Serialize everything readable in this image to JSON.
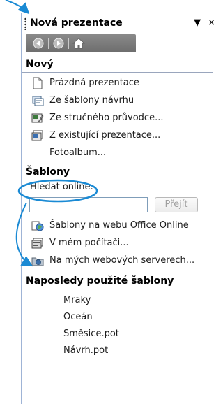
{
  "pane": {
    "title": "Nová prezentace",
    "dropdown_icon": "▼",
    "close_icon": "×"
  },
  "nav": {
    "back_icon": "arrow-left-icon",
    "forward_icon": "arrow-right-icon",
    "home_icon": "home-icon"
  },
  "new_section": {
    "heading": "Nový",
    "items": [
      {
        "label": "Prázdná prezentace",
        "icon": "blank-doc-icon"
      },
      {
        "label": "Ze šablony návrhu",
        "icon": "design-template-icon"
      },
      {
        "label": "Ze stručného průvodce...",
        "icon": "wizard-icon"
      },
      {
        "label": "Z existující prezentace...",
        "icon": "existing-presentation-icon"
      },
      {
        "label": "Fotoalbum...",
        "icon": ""
      }
    ]
  },
  "templates_section": {
    "heading": "Šablony",
    "search_label": "Hledat online:",
    "search_value": "",
    "go_label": "Přejít",
    "items": [
      {
        "label": "Šablony na webu Office Online",
        "icon": "globe-icon"
      },
      {
        "label": "V mém počítači...",
        "icon": "computer-templates-icon"
      },
      {
        "label": "Na mých webových serverech...",
        "icon": "web-folder-icon"
      }
    ]
  },
  "recent_section": {
    "heading": "Naposledy použité šablony",
    "items": [
      "Mraky",
      "Oceán",
      "Směsice.pot",
      "Návrh.pot"
    ]
  },
  "colors": {
    "annotation": "#1a8ad4",
    "border": "#9fb4d6",
    "navbar": "#7a7a7a"
  }
}
